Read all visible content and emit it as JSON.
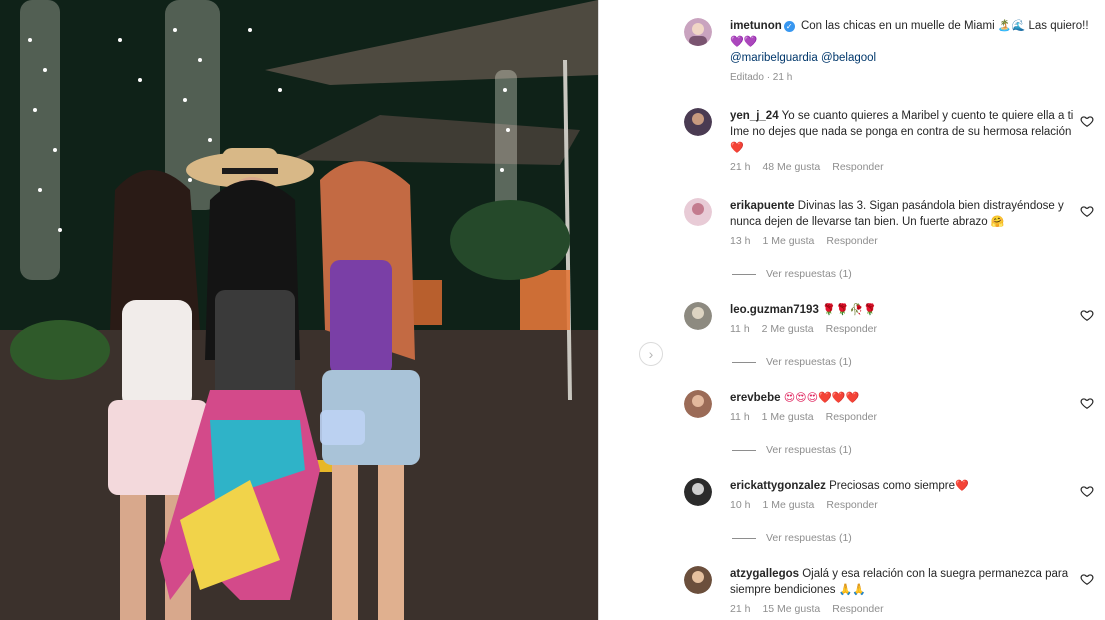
{
  "post": {
    "username": "imetunon",
    "caption_text": "Con las chicas en un muelle de Miami",
    "caption_emoji": "🏝️🌊",
    "caption_tail": "Las quiero!!",
    "caption_hearts": "💜💜",
    "mention_1": "@maribelguardia",
    "mention_2": "@belagool",
    "edited": "Editado · 21 h"
  },
  "comments": [
    {
      "username": "yen_j_24",
      "text": "Yo se cuanto quieres a Maribel y cuento te quiere ella a ti Ime no dejes que nada se ponga en contra de su hermosa relación",
      "emoji": "❤️",
      "time": "21 h",
      "likes": "48 Me gusta",
      "reply": "Responder",
      "replies": ""
    },
    {
      "username": "erikapuente",
      "text": "Divinas las 3. Sigan pasándola bien distrayéndose y nunca dejen de llevarse tan bien. Un fuerte abrazo",
      "emoji": "🤗",
      "time": "13 h",
      "likes": "1 Me gusta",
      "reply": "Responder",
      "replies": "Ver respuestas (1)"
    },
    {
      "username": "leo.guzman7193",
      "text": "",
      "emoji": "🌹🌹🥀🌹",
      "time": "11 h",
      "likes": "2 Me gusta",
      "reply": "Responder",
      "replies": "Ver respuestas (1)"
    },
    {
      "username": "erevbebe",
      "text": "",
      "emoji": "😍😍😍❤️❤️❤️",
      "time": "11 h",
      "likes": "1 Me gusta",
      "reply": "Responder",
      "replies": "Ver respuestas (1)"
    },
    {
      "username": "erickattygonzalez",
      "text": "Preciosas como siempre",
      "emoji": "❤️",
      "time": "10 h",
      "likes": "1 Me gusta",
      "reply": "Responder",
      "replies": "Ver respuestas (1)"
    },
    {
      "username": "atzygallegos",
      "text": "Ojalá y esa relación con la suegra permanezca para siempre bendiciones",
      "emoji": "🙏🙏",
      "time": "21 h",
      "likes": "15 Me gusta",
      "reply": "Responder",
      "replies": ""
    }
  ],
  "colors": {
    "accent": "#3897f0",
    "link": "#00376b",
    "muted": "#8e8e8e",
    "heart": "#e0245e"
  }
}
